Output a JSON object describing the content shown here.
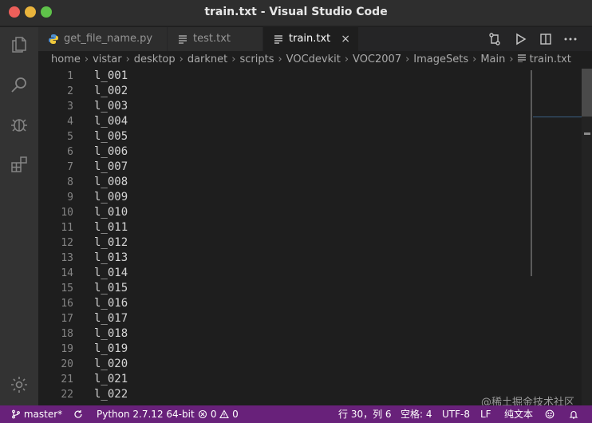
{
  "window": {
    "title": "train.txt - Visual Studio Code"
  },
  "activity_bar": {
    "items": [
      {
        "name": "explorer-icon"
      },
      {
        "name": "search-icon"
      },
      {
        "name": "debug-icon"
      },
      {
        "name": "extensions-icon"
      },
      {
        "name": "settings-gear-icon"
      }
    ]
  },
  "tabs": [
    {
      "label": "get_file_name.py",
      "icon": "python-file-icon",
      "active": false
    },
    {
      "label": "test.txt",
      "icon": "text-file-icon",
      "active": false
    },
    {
      "label": "train.txt",
      "icon": "text-file-icon",
      "active": true,
      "close": "×"
    }
  ],
  "tab_actions": [
    "compare-icon",
    "run-icon",
    "split-editor-icon",
    "more-icon"
  ],
  "breadcrumb": [
    "home",
    "vistar",
    "desktop",
    "darknet",
    "scripts",
    "VOCdevkit",
    "VOC2007",
    "ImageSets",
    "Main",
    "train.txt"
  ],
  "breadcrumb_separator": "›",
  "editor": {
    "lines": [
      {
        "n": "1",
        "text": "l_001"
      },
      {
        "n": "2",
        "text": "l_002"
      },
      {
        "n": "3",
        "text": "l_003"
      },
      {
        "n": "4",
        "text": "l_004"
      },
      {
        "n": "5",
        "text": "l_005"
      },
      {
        "n": "6",
        "text": "l_006"
      },
      {
        "n": "7",
        "text": "l_007"
      },
      {
        "n": "8",
        "text": "l_008"
      },
      {
        "n": "9",
        "text": "l_009"
      },
      {
        "n": "10",
        "text": "l_010"
      },
      {
        "n": "11",
        "text": "l_011"
      },
      {
        "n": "12",
        "text": "l_012"
      },
      {
        "n": "13",
        "text": "l_013"
      },
      {
        "n": "14",
        "text": "l_014"
      },
      {
        "n": "15",
        "text": "l_015"
      },
      {
        "n": "16",
        "text": "l_016"
      },
      {
        "n": "17",
        "text": "l_017"
      },
      {
        "n": "18",
        "text": "l_018"
      },
      {
        "n": "19",
        "text": "l_019"
      },
      {
        "n": "20",
        "text": "l_020"
      },
      {
        "n": "21",
        "text": "l_021"
      },
      {
        "n": "22",
        "text": "l_022"
      }
    ]
  },
  "status_bar": {
    "branch": "master*",
    "python": "Python 2.7.12 64-bit",
    "errors": "0",
    "warnings": "0",
    "position": "行 30，列 6",
    "spaces": "空格: 4",
    "encoding": "UTF-8",
    "eol": "LF",
    "language": "纯文本"
  },
  "watermark": "@稀土掘金技术社区",
  "colors": {
    "status_bar": "#68217a",
    "editor_bg": "#1e1e1e",
    "activity_bar": "#333333"
  }
}
